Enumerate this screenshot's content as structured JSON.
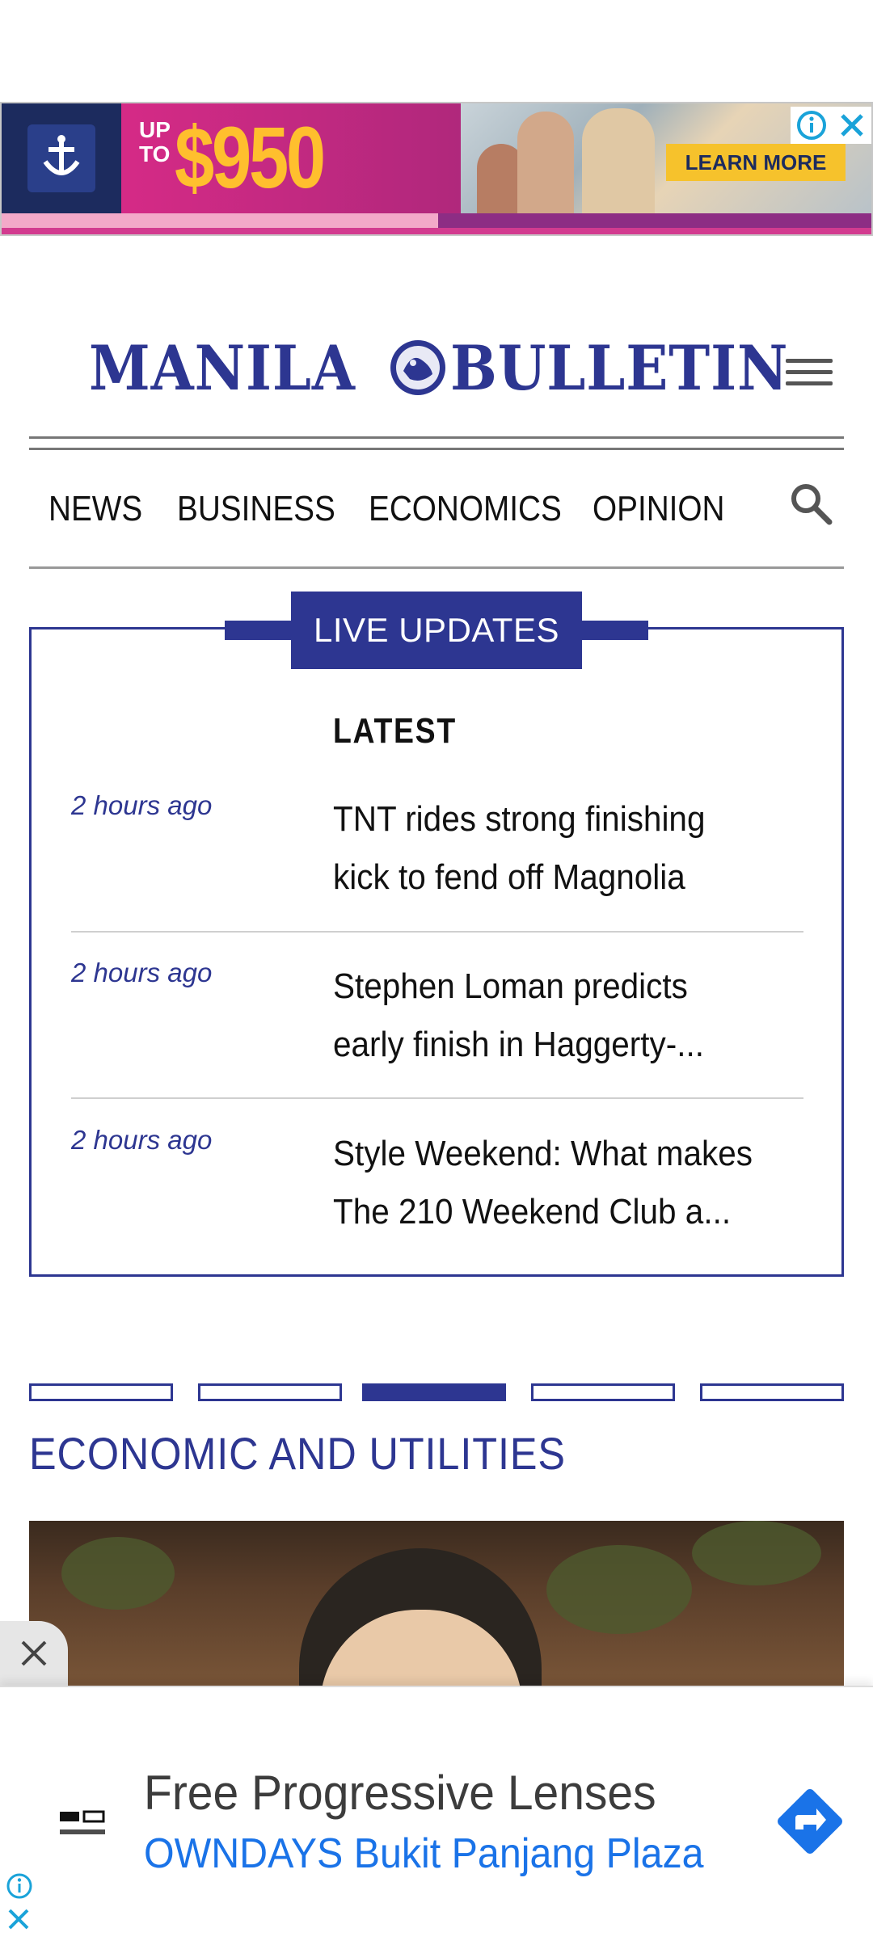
{
  "top_ad": {
    "brand_icon": "crown-anchor-icon",
    "upto": "UP TO",
    "amount": "$950 OFF",
    "cta": "LEARN MORE",
    "colors": {
      "brand_bg": "#1c2b5e",
      "offer_bg": "#d52a86",
      "amount": "#ffbf2e",
      "cta_bg": "#f6c22c"
    }
  },
  "header": {
    "masthead_left": "MANILA",
    "masthead_right": "BULLETIN",
    "menu_icon": "hamburger-menu-icon"
  },
  "nav": {
    "items": [
      "NEWS",
      "BUSINESS",
      "ECONOMICS",
      "OPINION"
    ],
    "search_icon": "search-icon"
  },
  "live": {
    "tab_label": "LIVE UPDATES",
    "latest_label": "LATEST",
    "items": [
      {
        "time": "2 hours ago",
        "headline": "TNT rides strong finishing kick to fend off Magnolia"
      },
      {
        "time": "2 hours ago",
        "headline": "Stephen Loman predicts early finish in Haggerty-..."
      },
      {
        "time": "2 hours ago",
        "headline": "Style Weekend: What makes The 210 Weekend Club a..."
      }
    ]
  },
  "carousel": {
    "slide_count": 5,
    "active_index": 2,
    "section_title": "ECONOMIC AND UTILITIES"
  },
  "bottom_ad": {
    "brand": "OWNDAYS",
    "title": "Free Progressive Lenses",
    "subtitle": "OWNDAYS Bukit Panjang Plaza",
    "arrow_icon": "directions-arrow-icon",
    "colors": {
      "accent": "#1a73e8"
    }
  },
  "theme": {
    "brand_blue": "#2d3691"
  }
}
